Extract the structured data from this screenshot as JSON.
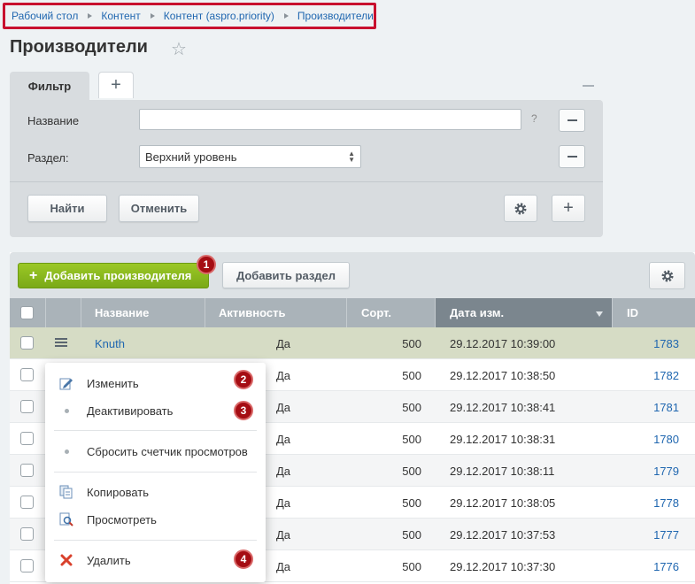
{
  "breadcrumb": [
    "Рабочий стол",
    "Контент",
    "Контент (aspro.priority)",
    "Производители"
  ],
  "page_title": "Производители",
  "filter": {
    "tab_label": "Фильтр",
    "add_tab": "+",
    "name_label": "Название",
    "name_value": "",
    "help": "?",
    "section_label": "Раздел:",
    "section_value": "Верхний уровень",
    "find_button": "Найти",
    "cancel_button": "Отменить"
  },
  "toolbar": {
    "add_manufacturer": "Добавить производителя",
    "add_section": "Добавить раздел"
  },
  "badges": [
    "1",
    "2",
    "3",
    "4"
  ],
  "columns": [
    "Название",
    "Активность",
    "Сорт.",
    "Дата изм.",
    "ID"
  ],
  "rows": [
    {
      "name": "Knuth",
      "active": "Да",
      "sort": "500",
      "date": "29.12.2017 10:39:00",
      "id": "1783"
    },
    {
      "name": "",
      "active": "Да",
      "sort": "500",
      "date": "29.12.2017 10:38:50",
      "id": "1782"
    },
    {
      "name": "",
      "active": "Да",
      "sort": "500",
      "date": "29.12.2017 10:38:41",
      "id": "1781"
    },
    {
      "name": "",
      "active": "Да",
      "sort": "500",
      "date": "29.12.2017 10:38:31",
      "id": "1780"
    },
    {
      "name": "",
      "active": "Да",
      "sort": "500",
      "date": "29.12.2017 10:38:11",
      "id": "1779"
    },
    {
      "name": "",
      "active": "Да",
      "sort": "500",
      "date": "29.12.2017 10:38:05",
      "id": "1778"
    },
    {
      "name": "",
      "active": "Да",
      "sort": "500",
      "date": "29.12.2017 10:37:53",
      "id": "1777"
    },
    {
      "name": "",
      "active": "Да",
      "sort": "500",
      "date": "29.12.2017 10:37:30",
      "id": "1776"
    }
  ],
  "context_menu": {
    "edit": "Изменить",
    "deactivate": "Деактивировать",
    "reset_counter": "Сбросить счетчик просмотров",
    "copy": "Копировать",
    "view": "Просмотреть",
    "delete": "Удалить"
  },
  "colors": {
    "highlight": "#c8102e",
    "accent_green": "#8bbd1f",
    "badge": "#a50d13",
    "link": "#2067b0",
    "selected_row": "#d6dcc5"
  }
}
